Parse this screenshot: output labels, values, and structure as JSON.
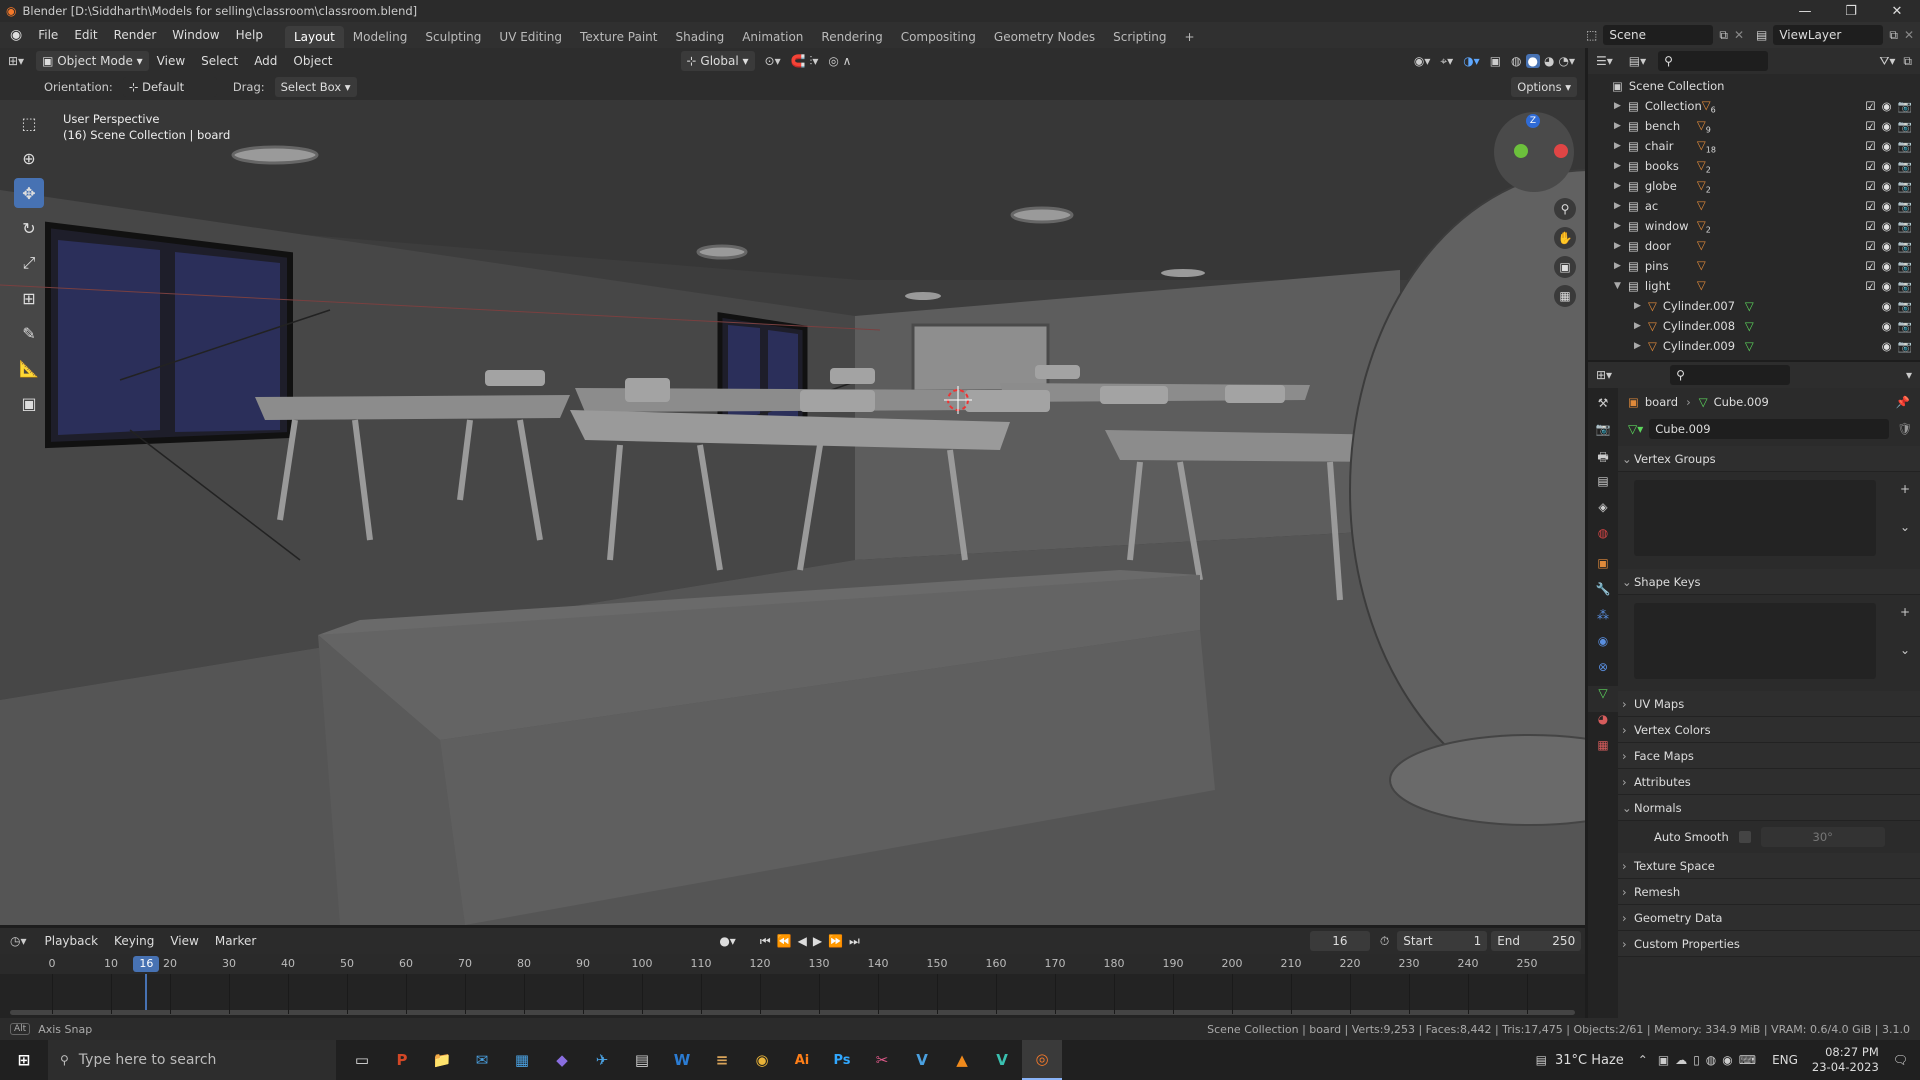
{
  "window": {
    "title": "Blender [D:\\Siddharth\\Models for selling\\classroom\\classroom.blend]",
    "min": "—",
    "max": "❐",
    "close": "✕"
  },
  "menu": [
    "File",
    "Edit",
    "Render",
    "Window",
    "Help"
  ],
  "workspaces": [
    "Layout",
    "Modeling",
    "Sculpting",
    "UV Editing",
    "Texture Paint",
    "Shading",
    "Animation",
    "Rendering",
    "Compositing",
    "Geometry Nodes",
    "Scripting"
  ],
  "scene": {
    "name": "Scene",
    "view_layer": "ViewLayer"
  },
  "viewport_header": {
    "mode": "Object Mode",
    "menus": [
      "View",
      "Select",
      "Add",
      "Object"
    ],
    "transform": "Global",
    "orientation_label": "Orientation:",
    "orientation": "Default",
    "drag_label": "Drag:",
    "drag": "Select Box",
    "options": "Options"
  },
  "viewport": {
    "perspective": "User Perspective",
    "context": "(16) Scene Collection | board",
    "gizmo": {
      "z": "Z"
    }
  },
  "timeline": {
    "menus": [
      "Playback",
      "Keying",
      "View",
      "Marker"
    ],
    "current_frame": "16",
    "start_label": "Start",
    "start": "1",
    "end_label": "End",
    "end": "250",
    "ticks": [
      "0",
      "10",
      "20",
      "30",
      "40",
      "50",
      "60",
      "70",
      "80",
      "90",
      "100",
      "110",
      "120",
      "130",
      "140",
      "150",
      "160",
      "170",
      "180",
      "190",
      "200",
      "210",
      "220",
      "230",
      "240",
      "250"
    ],
    "playhead": "16"
  },
  "status": {
    "left": "Axis Snap",
    "key": "Alt",
    "right": "Scene Collection | board | Verts:9,253 | Faces:8,442 | Tris:17,475 | Objects:2/61 | Memory: 334.9 MiB | VRAM: 0.6/4.0 GiB | 3.1.0"
  },
  "outliner": {
    "root": "Scene Collection",
    "rows": [
      {
        "name": "Collection",
        "count": "6",
        "indent": 0
      },
      {
        "name": "bench",
        "count": "9",
        "indent": 0
      },
      {
        "name": "chair",
        "count": "18",
        "indent": 0
      },
      {
        "name": "books",
        "count": "2",
        "indent": 0
      },
      {
        "name": "globe",
        "count": "2",
        "indent": 0
      },
      {
        "name": "ac",
        "count": "",
        "indent": 0
      },
      {
        "name": "window",
        "count": "2",
        "indent": 0
      },
      {
        "name": "door",
        "count": "",
        "indent": 0
      },
      {
        "name": "pins",
        "count": "",
        "indent": 0
      },
      {
        "name": "light",
        "count": "",
        "indent": 0
      },
      {
        "name": "Cylinder.007",
        "count": "",
        "indent": 1
      },
      {
        "name": "Cylinder.008",
        "count": "",
        "indent": 1
      },
      {
        "name": "Cylinder.009",
        "count": "",
        "indent": 1
      }
    ]
  },
  "properties": {
    "breadcrumb_object": "board",
    "breadcrumb_mesh": "Cube.009",
    "datablock": "Cube.009",
    "panels_open": [
      "Vertex Groups",
      "Shape Keys"
    ],
    "panels": [
      "UV Maps",
      "Vertex Colors",
      "Face Maps",
      "Attributes"
    ],
    "normals": "Normals",
    "auto_smooth": "Auto Smooth",
    "angle": "30°",
    "panels_after": [
      "Texture Space",
      "Remesh",
      "Geometry Data",
      "Custom Properties"
    ]
  },
  "taskbar": {
    "search_placeholder": "Type here to search",
    "weather": "31°C  Haze",
    "lang": "ENG",
    "time": "08:27 PM",
    "date": "23-04-2023",
    "apps": [
      "P",
      "📁",
      "✉",
      "▦",
      "◆",
      "✈",
      "▤",
      "W",
      "≡",
      "◉",
      "Ai",
      "Ps",
      "✂",
      "V",
      "▲",
      "V",
      "◎"
    ]
  }
}
